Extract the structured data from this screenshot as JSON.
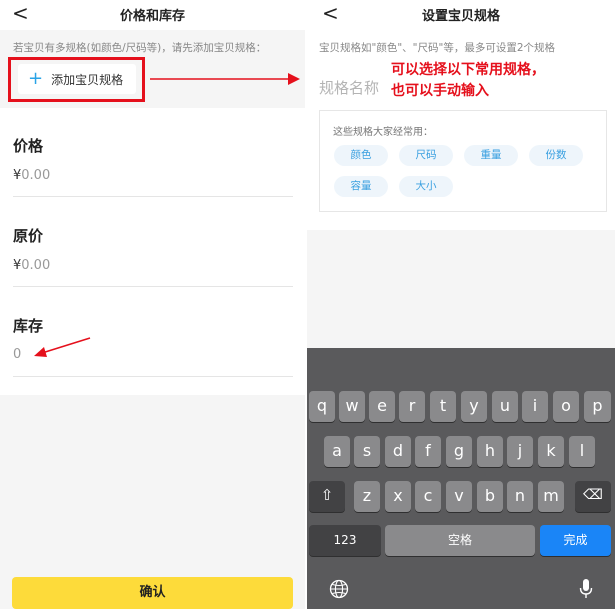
{
  "left": {
    "back_glyph": "<",
    "title": "价格和库存",
    "spec_note": "若宝贝有多规格(如颜色/尺码等)，请先添加宝贝规格：",
    "add_spec_label": "添加宝贝规格",
    "add_icon": "+",
    "fields": [
      {
        "label": "价格",
        "currency": "¥",
        "value": "0.00"
      },
      {
        "label": "原价",
        "currency": "¥",
        "value": "0.00"
      },
      {
        "label": "库存",
        "currency": "",
        "value": "0"
      }
    ],
    "confirm_label": "确认"
  },
  "right": {
    "back_glyph": "<",
    "title": "设置宝贝规格",
    "note": "宝贝规格如\"颜色\"、\"尺码\"等，最多可设置2个规格",
    "name_placeholder": "规格名称",
    "hint_line1": "可以选择以下常用规格，",
    "hint_line2": "也可以手动输入",
    "common_title": "这些规格大家经常用：",
    "chips": [
      "颜色",
      "尺码",
      "重量",
      "份数",
      "容量",
      "大小"
    ],
    "keyboard": {
      "row1": [
        "q",
        "w",
        "e",
        "r",
        "t",
        "y",
        "u",
        "i",
        "o",
        "p"
      ],
      "row2": [
        "a",
        "s",
        "d",
        "f",
        "g",
        "h",
        "j",
        "k",
        "l"
      ],
      "row3": [
        "z",
        "x",
        "c",
        "v",
        "b",
        "n",
        "m"
      ],
      "num_label": "123",
      "space_label": "空格",
      "done_label": "完成",
      "shift_icon": "⇧",
      "delete_icon": "⌫",
      "globe_icon": "globe",
      "mic_icon": "microphone"
    }
  },
  "colors": {
    "accent_red": "#e5101c",
    "chip_blue": "#3aa0e0",
    "confirm_yellow": "#fddb3a",
    "done_blue": "#1a85f7"
  }
}
